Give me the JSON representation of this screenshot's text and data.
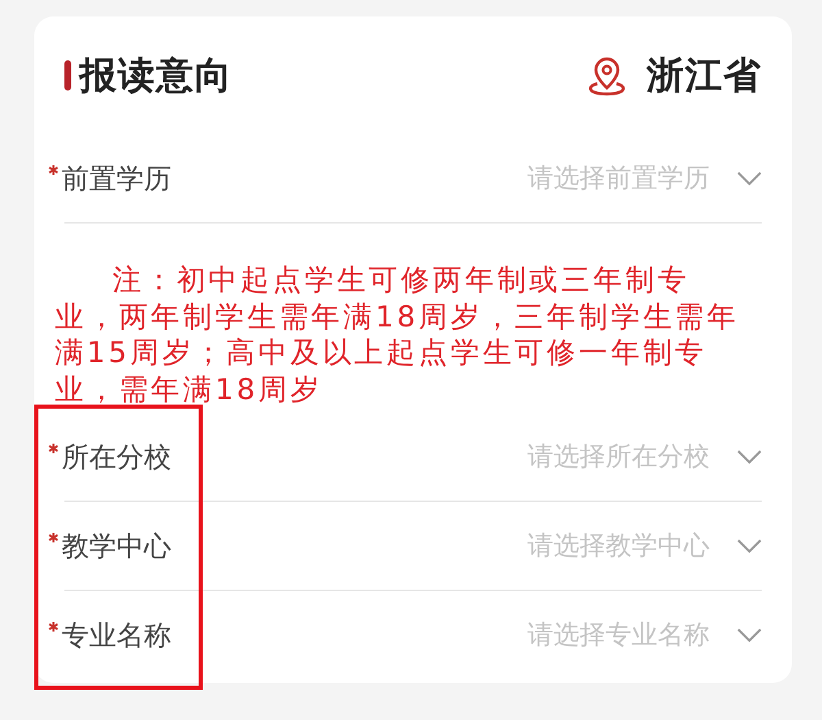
{
  "header": {
    "title": "报读意向",
    "location": "浙江省"
  },
  "fields": [
    {
      "label": "前置学历",
      "placeholder": "请选择前置学历",
      "required": true
    },
    {
      "label": "所在分校",
      "placeholder": "请选择所在分校",
      "required": true
    },
    {
      "label": "教学中心",
      "placeholder": "请选择教学中心",
      "required": true
    },
    {
      "label": "专业名称",
      "placeholder": "请选择专业名称",
      "required": true
    }
  ],
  "note": "注：初中起点学生可修两年制或三年制专业，两年制学生需年满18周岁，三年制学生需年满15周岁；高中及以上起点学生可修一年制专业，需年满18周岁",
  "annotation": {
    "kind": "frame"
  }
}
